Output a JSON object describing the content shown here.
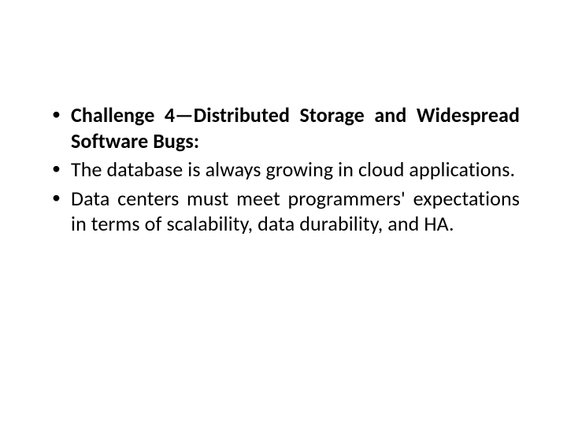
{
  "slide": {
    "bullets": [
      {
        "bold": "Challenge 4—Distributed Storage and Widespread Software Bugs:",
        "rest": ""
      },
      {
        "bold": "",
        "rest": "The database is always growing in cloud applications."
      },
      {
        "bold": "",
        "rest": "Data centers must meet programmers' expectations in terms of scalability, data durability, and HA."
      }
    ]
  }
}
